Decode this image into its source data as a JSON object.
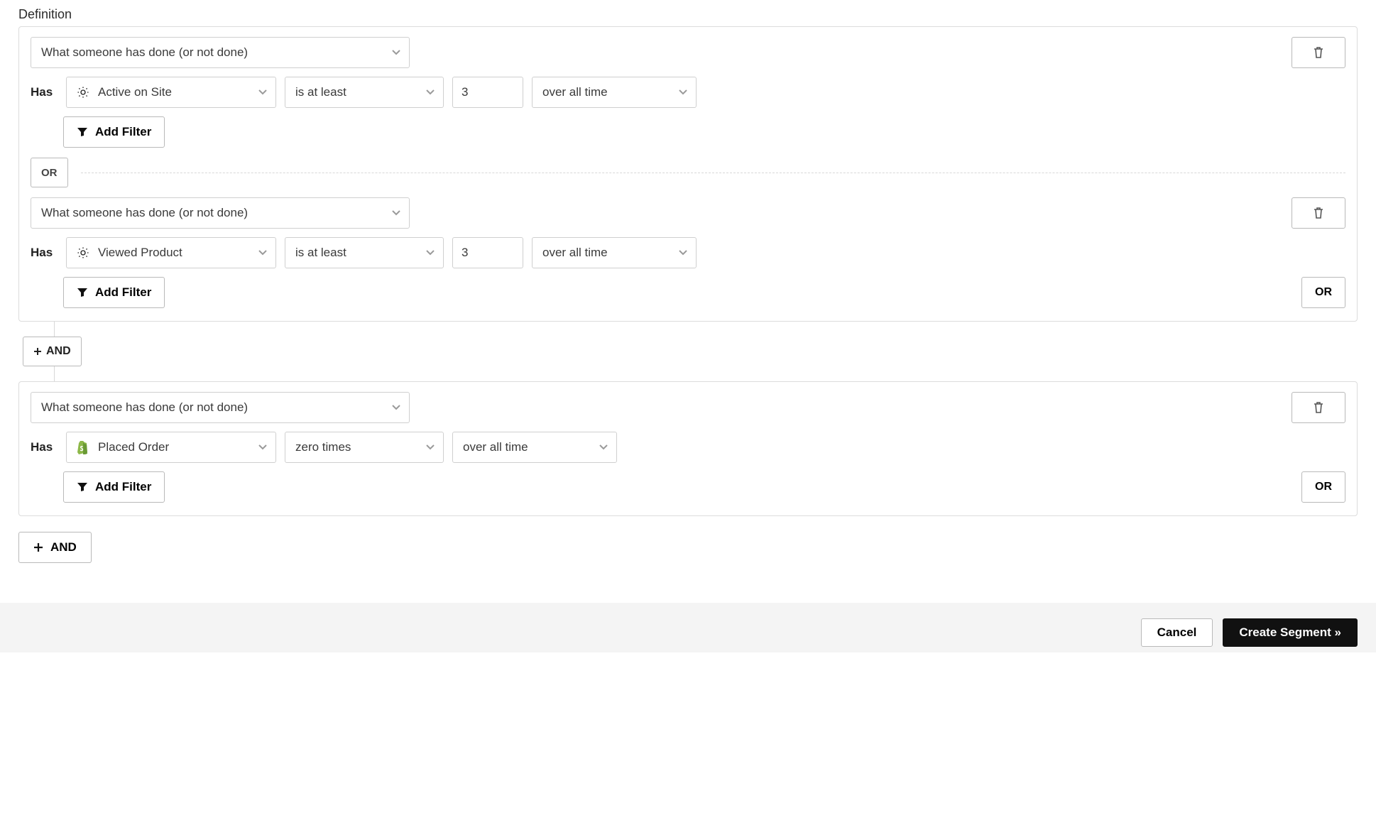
{
  "heading": "Definition",
  "labels": {
    "has": "Has",
    "add_filter": "Add Filter",
    "or": "OR",
    "and_connector": "AND",
    "and": "AND",
    "cancel": "Cancel",
    "create": "Create Segment »"
  },
  "groups": [
    {
      "conditions": [
        {
          "type_select": "What someone has done (or not done)",
          "event": "Active on Site",
          "event_icon": "gear",
          "operator": "is at least",
          "value": "3",
          "timeframe": "over all time",
          "show_value": true
        },
        {
          "type_select": "What someone has done (or not done)",
          "event": "Viewed Product",
          "event_icon": "gear",
          "operator": "is at least",
          "value": "3",
          "timeframe": "over all time",
          "show_value": true
        }
      ]
    },
    {
      "conditions": [
        {
          "type_select": "What someone has done (or not done)",
          "event": "Placed Order",
          "event_icon": "shopify",
          "operator": "zero times",
          "value": "",
          "timeframe": "over all time",
          "show_value": false
        }
      ]
    }
  ]
}
